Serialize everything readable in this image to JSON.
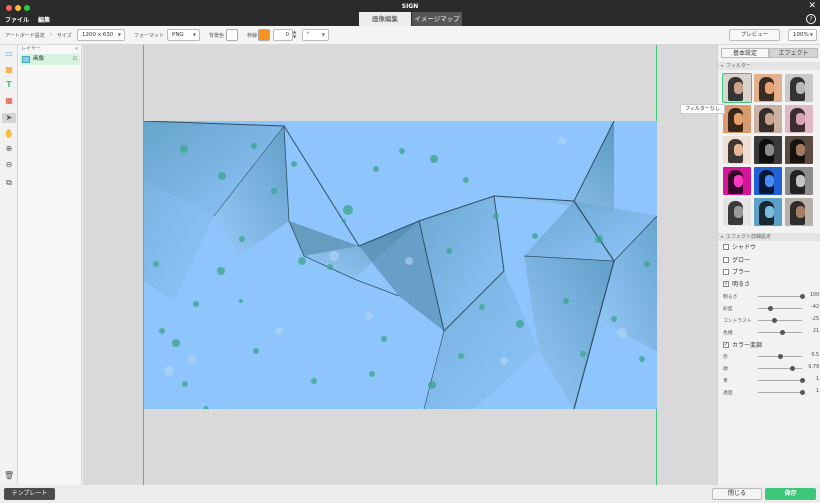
{
  "window": {
    "title": "SIGN"
  },
  "menu": [
    {
      "label": "ファイル"
    },
    {
      "label": "編集"
    }
  ],
  "tabs": [
    {
      "label": "画像編集",
      "active": true
    },
    {
      "label": "イメージマップ",
      "active": false
    }
  ],
  "toolbar": {
    "artboard_label": "アートボード設定",
    "size_label": "サイズ",
    "size_value": "1200 x 630",
    "format_label": "フォーマット",
    "format_value": "PNG",
    "bgcolor_label": "背景色",
    "border_label": "枠線",
    "border_color": "#f7931e",
    "border_width": "0",
    "preview_label": "プレビュー",
    "zoom_value": "100%"
  },
  "layers": {
    "title": "レイヤー",
    "items": [
      {
        "name": "画像"
      }
    ]
  },
  "bottom": {
    "template_label": "テンプレート",
    "close_label": "閉じる",
    "save_label": "保存"
  },
  "right_panel": {
    "tabs": [
      {
        "label": "基本設定",
        "active": false
      },
      {
        "label": "エフェクト",
        "active": true
      }
    ],
    "filter_header": "フィルター",
    "tooltip": "フィルターなし",
    "filters": [
      {
        "name": "none",
        "bg": "#d9d4cc",
        "face": "#caa48a"
      },
      {
        "name": "warm",
        "bg": "#e2b08a",
        "face": "#e7a270"
      },
      {
        "name": "gray",
        "bg": "#c9c9c9",
        "face": "#b8b8b8"
      },
      {
        "name": "sepia",
        "bg": "#d99a6d",
        "face": "#e8a06b"
      },
      {
        "name": "vintage",
        "bg": "#c9b1a4",
        "face": "#caa08e"
      },
      {
        "name": "pink",
        "bg": "#e1b9c4",
        "face": "#d9a3b2"
      },
      {
        "name": "bright",
        "bg": "#f0e0d3",
        "face": "#e9b693"
      },
      {
        "name": "noir",
        "bg": "#3a3a3a",
        "face": "#8a8a8a"
      },
      {
        "name": "dark",
        "bg": "#5a4a40",
        "face": "#a27a5f"
      },
      {
        "name": "magenta",
        "bg": "#d6159a",
        "face": "#ff3ac0"
      },
      {
        "name": "blue",
        "bg": "#1f62d6",
        "face": "#4a8cf3"
      },
      {
        "name": "mono",
        "bg": "#8c8c8c",
        "face": "#c4c4c4"
      },
      {
        "name": "bw",
        "bg": "#e4e4e4",
        "face": "#9a9a9a"
      },
      {
        "name": "cyan",
        "bg": "#5da0c7",
        "face": "#7bbbe0"
      },
      {
        "name": "brown",
        "bg": "#b7b1aa",
        "face": "#a77e63"
      }
    ],
    "effect_header": "エフェクト詳細設定",
    "effects": [
      {
        "label": "シャドウ",
        "checked": ""
      },
      {
        "label": "グロー",
        "checked": ""
      },
      {
        "label": "ブラー",
        "checked": ""
      },
      {
        "label": "明るさ",
        "checked": "✓"
      }
    ],
    "brightness_sliders": [
      {
        "label": "明るさ",
        "value": "100",
        "fraction": 1.0
      },
      {
        "label": "彩度",
        "value": "-42",
        "fraction": 0.29
      },
      {
        "label": "コントラスト",
        "value": "-25",
        "fraction": 0.375
      },
      {
        "label": "色相",
        "value": "21",
        "fraction": 0.55
      }
    ],
    "color_adjust": {
      "label": "カラー変調",
      "checked": "✓"
    },
    "color_sliders": [
      {
        "label": "赤",
        "value": "0.5",
        "fraction": 0.5
      },
      {
        "label": "緑",
        "value": "0.79",
        "fraction": 0.79
      },
      {
        "label": "青",
        "value": "1",
        "fraction": 1.0
      },
      {
        "label": "透過",
        "value": "1",
        "fraction": 1.0
      }
    ]
  }
}
